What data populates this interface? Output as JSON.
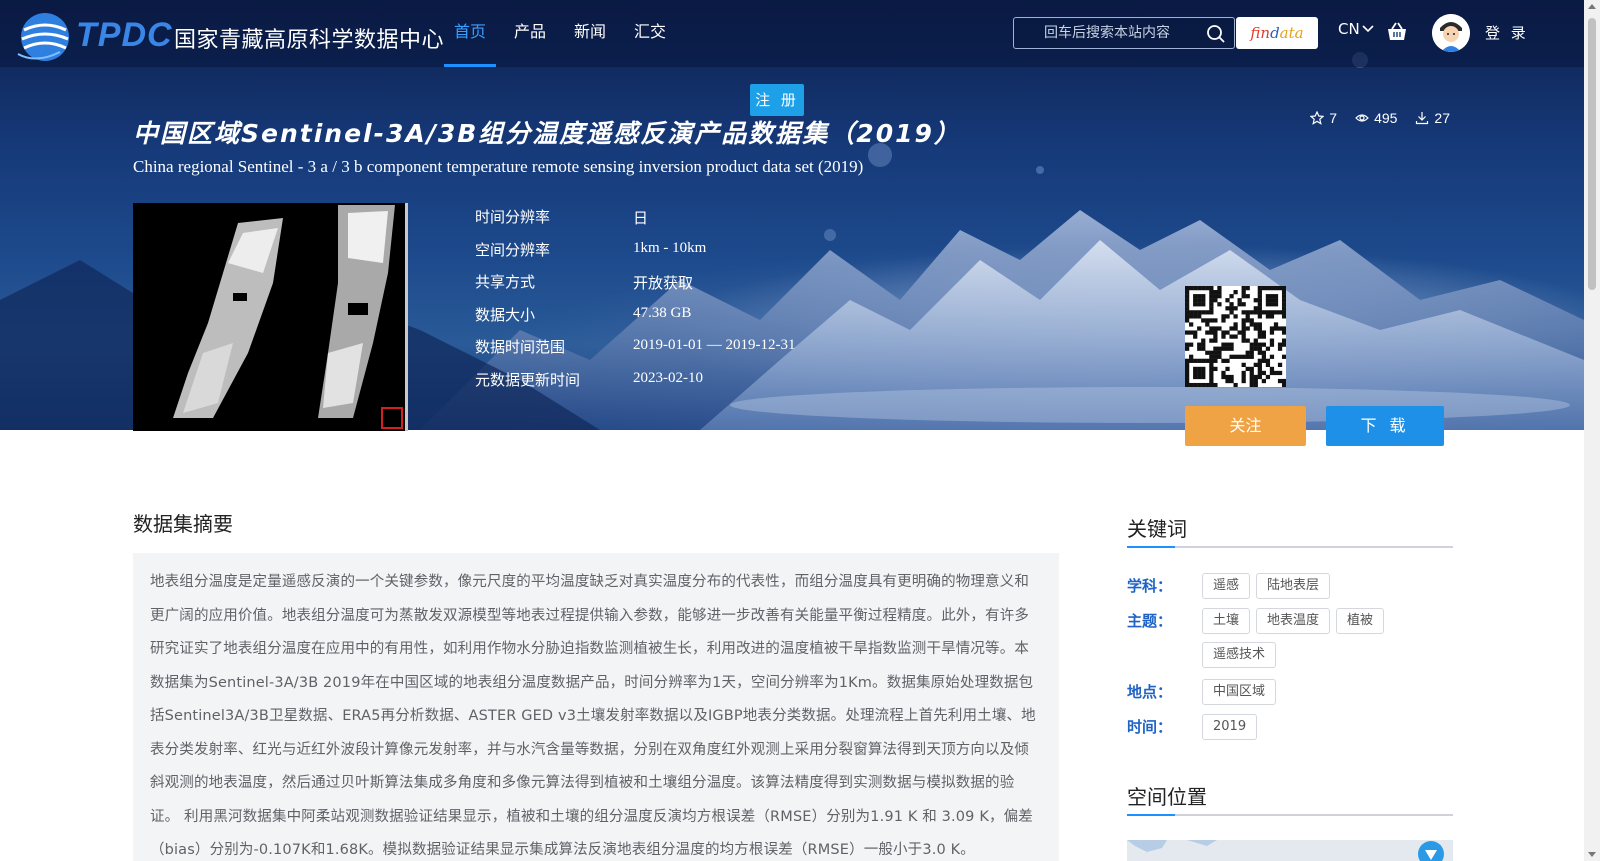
{
  "header": {
    "logo_abbr": "TPDC",
    "logo_name": "国家青藏高原科学数据中心",
    "nav": [
      "首页",
      "产品",
      "新闻",
      "汇交"
    ],
    "nav_active": "首页",
    "search_placeholder": "回车后搜索本站内容",
    "findata": {
      "p1": "fin",
      "p2": "d",
      "p3": "ata"
    },
    "lang": "CN",
    "login": "登 录",
    "register": "注 册"
  },
  "dataset": {
    "title_cn": "中国区域Sentinel-3A/3B组分温度遥感反演产品数据集（2019）",
    "title_en": "China regional Sentinel - 3 a / 3 b component temperature remote sensing inversion product data set (2019)",
    "stats": {
      "stars": "7",
      "views": "495",
      "downloads": "27"
    },
    "meta": [
      {
        "label": "时间分辨率",
        "value": "日"
      },
      {
        "label": "空间分辨率",
        "value": "1km - 10km"
      },
      {
        "label": "共享方式",
        "value": "开放获取"
      },
      {
        "label": "数据大小",
        "value": "47.38 GB"
      },
      {
        "label": "数据时间范围",
        "value": "2019-01-01 — 2019-12-31"
      },
      {
        "label": "元数据更新时间",
        "value": "2023-02-10"
      }
    ],
    "follow": "关注",
    "download": "下 载"
  },
  "abstract": {
    "title": "数据集摘要",
    "text": "地表组分温度是定量遥感反演的一个关键参数，像元尺度的平均温度缺乏对真实温度分布的代表性，而组分温度具有更明确的物理意义和更广阔的应用价值。地表组分温度可为蒸散发双源模型等地表过程提供输入参数，能够进一步改善有关能量平衡过程精度。此外，有许多研究证实了地表组分温度在应用中的有用性，如利用作物水分胁迫指数监测植被生长，利用改进的温度植被干旱指数监测干旱情况等。本数据集为Sentinel-3A/3B 2019年在中国区域的地表组分温度数据产品，时间分辨率为1天，空间分辨率为1Km。数据集原始处理数据包括Sentinel3A/3B卫星数据、ERA5再分析数据、ASTER GED v3土壤发射率数据以及IGBP地表分类数据。处理流程上首先利用土壤、地表分类发射率、红光与近红外波段计算像元发射率，并与水汽含量等数据，分别在双角度红外观测上采用分裂窗算法得到天顶方向以及倾斜观测的地表温度，然后通过贝叶斯算法集成多角度和多像元算法得到植被和土壤组分温度。该算法精度得到实测数据与模拟数据的验证。 利用黑河数据集中阿柔站观测数据验证结果显示，植被和土壤的组分温度反演均方根误差（RMSE）分别为1.91 K 和 3.09 K，偏差（bias）分别为-0.107K和1.68K。模拟数据验证结果显示集成算法反演地表组分温度的均方根误差（RMSE）一般小于3.0 K。"
  },
  "keywords": {
    "title": "关键词",
    "groups": [
      {
        "label": "学科：",
        "tags": [
          "遥感",
          "陆地表层"
        ]
      },
      {
        "label": "主题：",
        "tags": [
          "土壤",
          "地表温度",
          "植被",
          "遥感技术"
        ]
      },
      {
        "label": "地点：",
        "tags": [
          "中国区域"
        ]
      },
      {
        "label": "时间：",
        "tags": [
          "2019"
        ]
      }
    ]
  },
  "location": {
    "title": "空间位置"
  },
  "colors": {
    "accent": "#1e90ff",
    "follow": "#f0a345",
    "download": "#1e90e8",
    "keyword_label": "#1f63c6"
  }
}
